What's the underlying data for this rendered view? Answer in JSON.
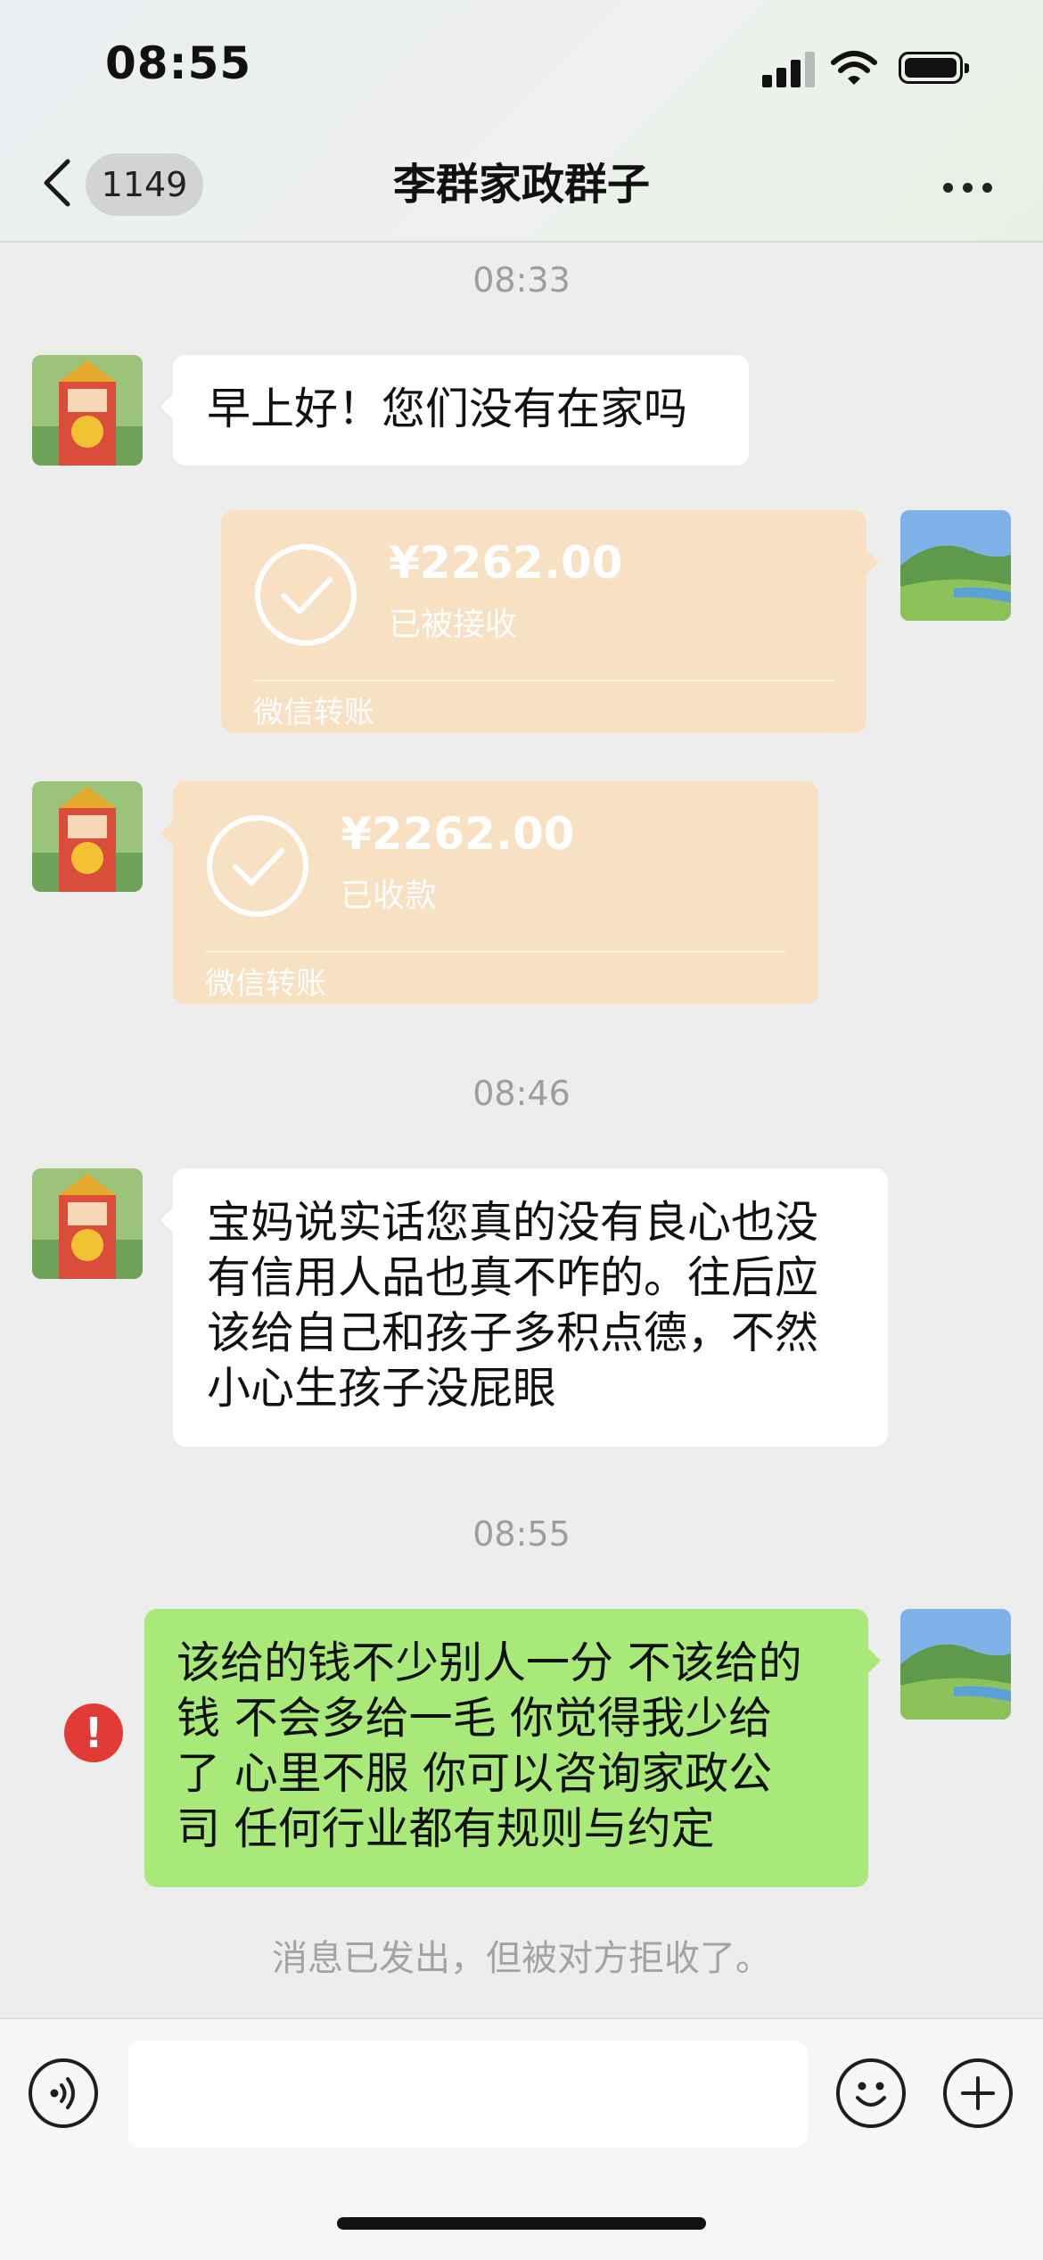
{
  "status_bar": {
    "time": "08:55",
    "signal_icon": "cellular-signal-icon",
    "wifi_icon": "wifi-icon",
    "battery_icon": "battery-icon"
  },
  "header": {
    "back_icon": "chevron-left-icon",
    "unread_count": "1149",
    "title": "李群家政群子",
    "more_icon": "more-dots-icon"
  },
  "messages": [
    {
      "type": "timestamp",
      "text": "08:33"
    },
    {
      "type": "text",
      "side": "left",
      "text": "早上好！您们没有在家吗"
    },
    {
      "type": "transfer",
      "side": "right",
      "amount": "¥2262.00",
      "status": "已被接收",
      "label": "微信转账"
    },
    {
      "type": "transfer",
      "side": "left",
      "amount": "¥2262.00",
      "status": "已收款",
      "label": "微信转账"
    },
    {
      "type": "timestamp",
      "text": "08:46"
    },
    {
      "type": "text",
      "side": "left",
      "text": "宝妈说实话您真的没有良心也没\n有信用人品也真不咋的。往后应\n该给自己和孩子多积点德，不然\n小心生孩子没屁眼"
    },
    {
      "type": "timestamp",
      "text": "08:55"
    },
    {
      "type": "text",
      "side": "right",
      "text": "该给的钱不少别人一分 不该给的\n钱 不会多给一毛 你觉得我少给\n了 心里不服 你可以咨询家政公\n司 任何行业都有规则与约定",
      "error_icon": "error-exclamation-icon",
      "error_symbol": "!"
    }
  ],
  "system_note": "消息已发出，但被对方拒收了。",
  "input_bar": {
    "voice_icon": "voice-input-icon",
    "message_value": "",
    "emoji_icon": "emoji-icon",
    "plus_icon": "plus-icon"
  },
  "colors": {
    "background": "#ededed",
    "outgoing_bubble": "#a9e97a",
    "incoming_bubble": "#ffffff",
    "transfer_card": "#f8e0c2",
    "error_badge": "#e23b36"
  }
}
